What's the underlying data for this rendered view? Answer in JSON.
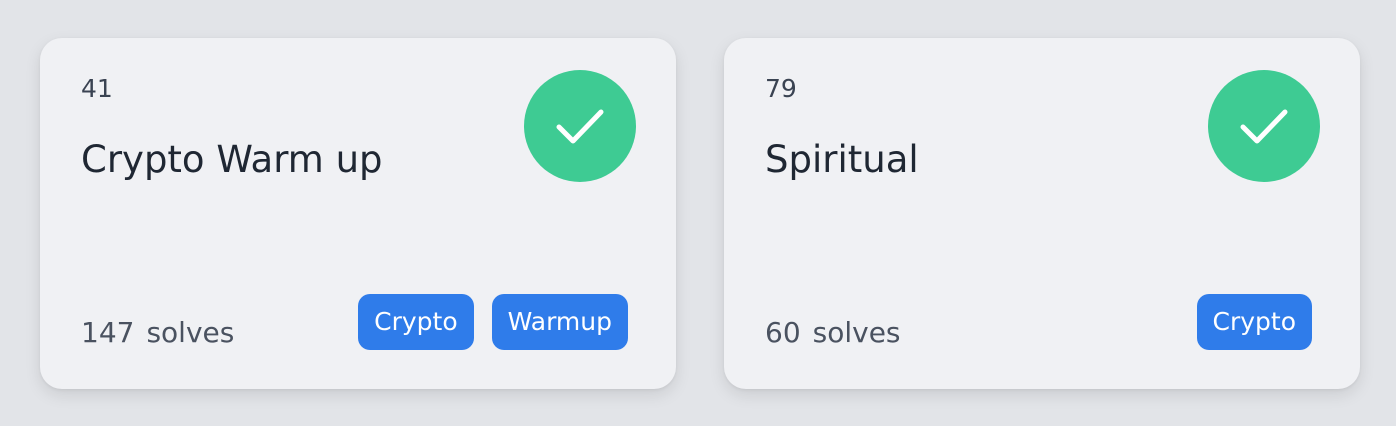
{
  "challenges": [
    {
      "points": "41",
      "title": "Crypto Warm up",
      "solves_count": "147",
      "solves_label": "solves",
      "solved": true,
      "status_icon": "checkmark-icon",
      "tags": [
        "Crypto",
        "Warmup"
      ]
    },
    {
      "points": "79",
      "title": "Spiritual",
      "solves_count": "60",
      "solves_label": "solves",
      "solved": true,
      "status_icon": "checkmark-icon",
      "tags": [
        "Crypto"
      ]
    }
  ],
  "colors": {
    "page_background": "#e2e4e8",
    "card_background": "#f0f1f4",
    "solved_badge": "#3ecb93",
    "tag_background": "#2f7cea",
    "tag_text": "#ffffff"
  }
}
